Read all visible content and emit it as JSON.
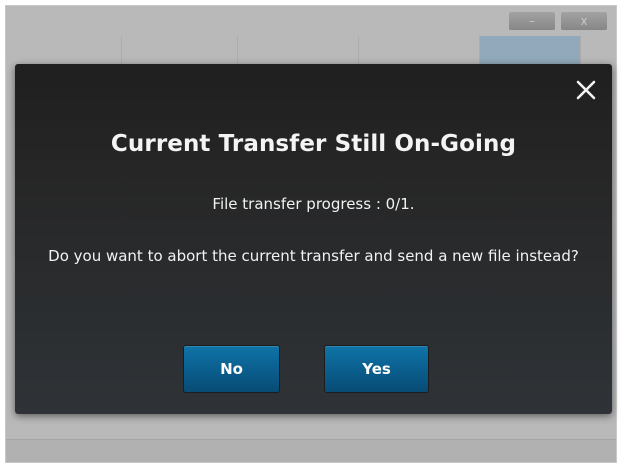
{
  "dialog": {
    "title": "Current Transfer Still On-Going",
    "progress_text": "File transfer progress : 0/1.",
    "question_text": "Do you want to abort the current transfer and send a new file instead?",
    "no_label": "No",
    "yes_label": "Yes",
    "close_icon": "close-icon"
  },
  "background_window": {
    "minimize_glyph": "–",
    "close_glyph": "x",
    "accent_color": "#9fc3de"
  },
  "colors": {
    "dialog_background": "#262626",
    "button": "#0a5d8c",
    "text": "#f2f2f2"
  }
}
